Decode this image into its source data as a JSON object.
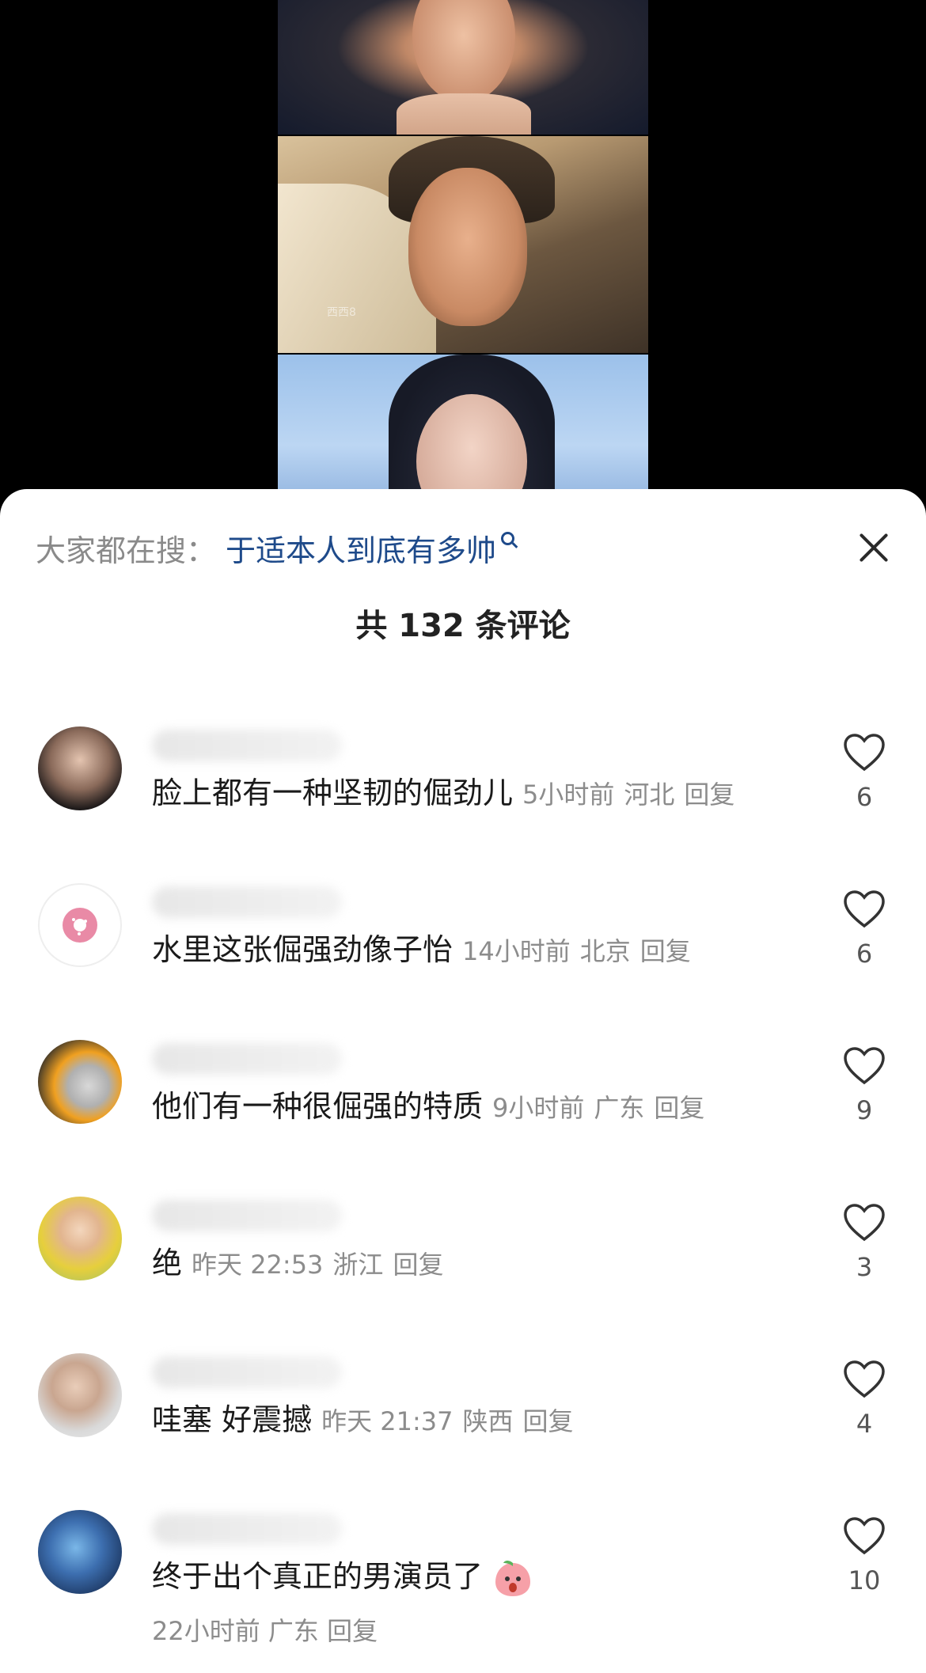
{
  "search_bar": {
    "prefix": "大家都在搜：",
    "query": "于适本人到底有多帅"
  },
  "video": {
    "watermark": "西西8"
  },
  "comments_header": {
    "title": "共 132 条评论"
  },
  "comments": [
    {
      "text": "脸上都有一种坚韧的倔劲儿",
      "time": "5小时前",
      "location": "河北",
      "reply": "回复",
      "likes": "6"
    },
    {
      "text": "水里这张倔强劲像子怡",
      "time": "14小时前",
      "location": "北京",
      "reply": "回复",
      "likes": "6"
    },
    {
      "text": "他们有一种很倔强的特质",
      "time": "9小时前",
      "location": "广东",
      "reply": "回复",
      "likes": "9"
    },
    {
      "text": "绝",
      "time": "昨天 22:53",
      "location": "浙江",
      "reply": "回复",
      "likes": "3"
    },
    {
      "text": "哇塞 好震撼",
      "time": "昨天 21:37",
      "location": "陕西",
      "reply": "回复",
      "likes": "4"
    },
    {
      "text": "终于出个真正的男演员了",
      "time": "22小时前",
      "location": "广东",
      "reply": "回复",
      "likes": "10"
    }
  ],
  "icons": {
    "close": "close-icon",
    "like": "heart-icon",
    "search": "search-icon"
  },
  "colors": {
    "search_query": "#1e4a8a",
    "meta_text": "#8c8c8c"
  }
}
